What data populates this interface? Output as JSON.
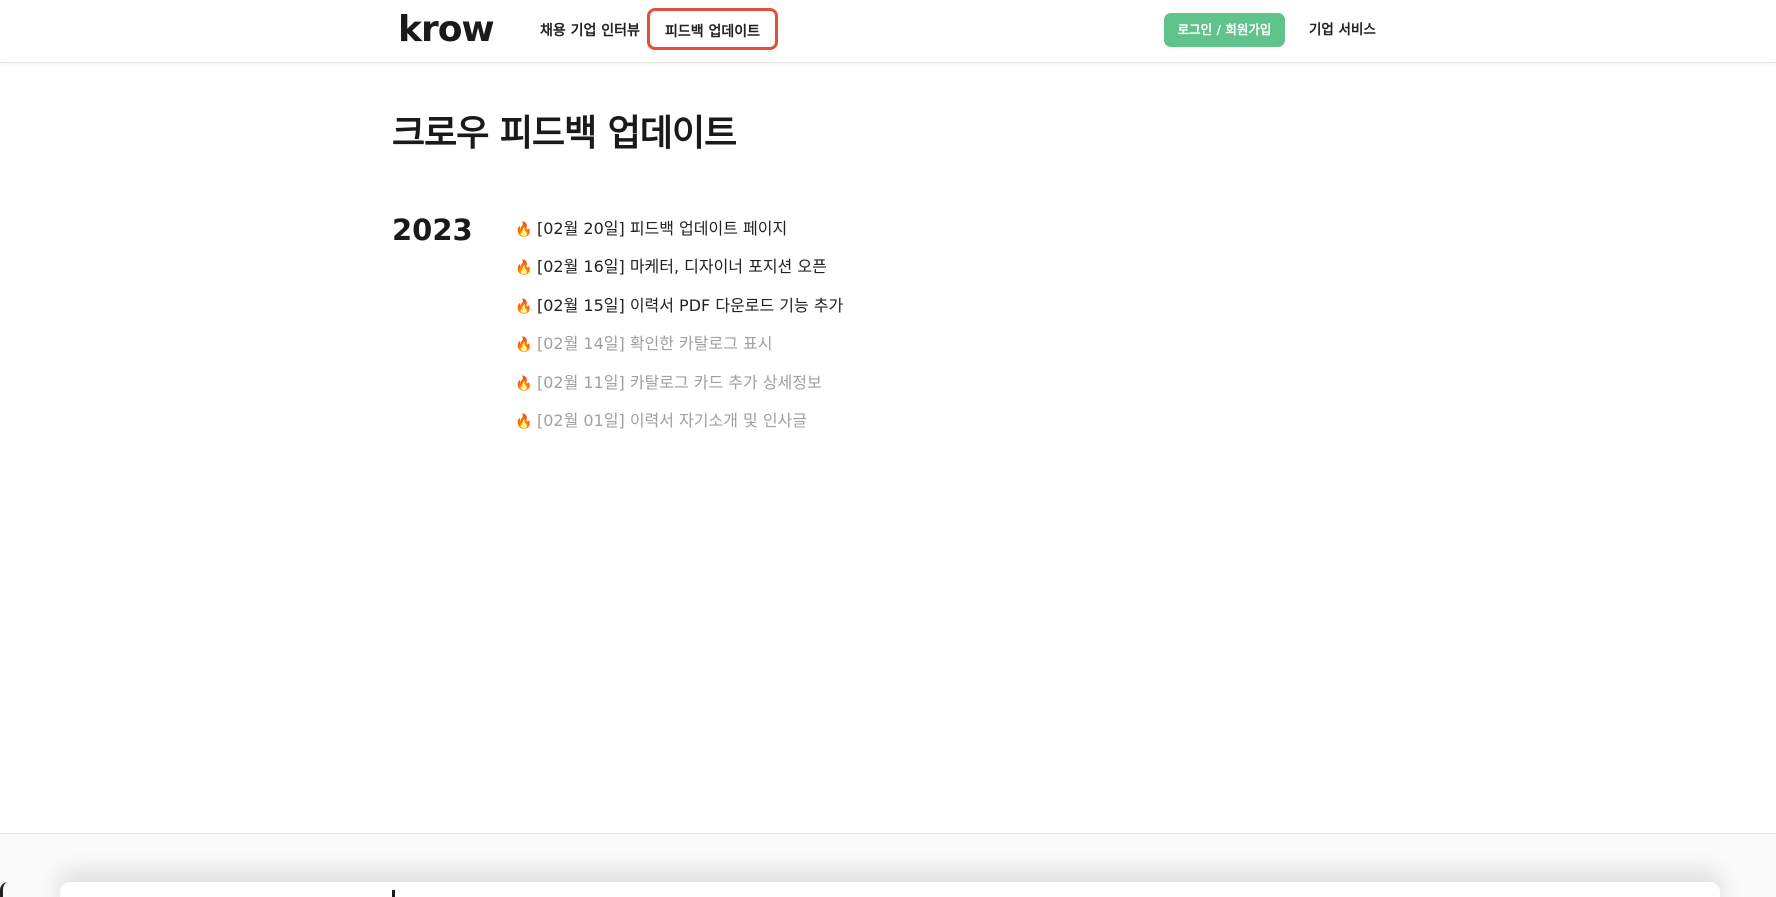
{
  "header": {
    "logo": "krow",
    "nav": {
      "interview": "채용 기업 인터뷰",
      "feedback": "피드백 업데이트"
    },
    "login_label": "로그인 / 회원가입",
    "biz_service_label": "기업 서비스"
  },
  "main": {
    "title": "크로우 피드백 업데이트",
    "year": "2023",
    "flame_icon": "🔥",
    "updates": [
      {
        "text": "[02월 20일] 피드백 업데이트 페이지"
      },
      {
        "text": "[02월 16일] 마케터, 디자이너 포지션 오픈"
      },
      {
        "text": "[02월 15일] 이력서 PDF 다운로드 기능 추가"
      },
      {
        "text": "[02월 14일] 확인한 카탈로그 표시"
      },
      {
        "text": "[02월 11일] 카탈로그 카드 추가 상세정보"
      },
      {
        "text": "[02월 01일] 이력서 자기소개 및 인사글"
      }
    ]
  },
  "colors": {
    "accent_green": "#5fc38b",
    "highlight_red": "#e2503a",
    "dim_text": "#a0a0a0",
    "flame": "#f06a1d"
  }
}
